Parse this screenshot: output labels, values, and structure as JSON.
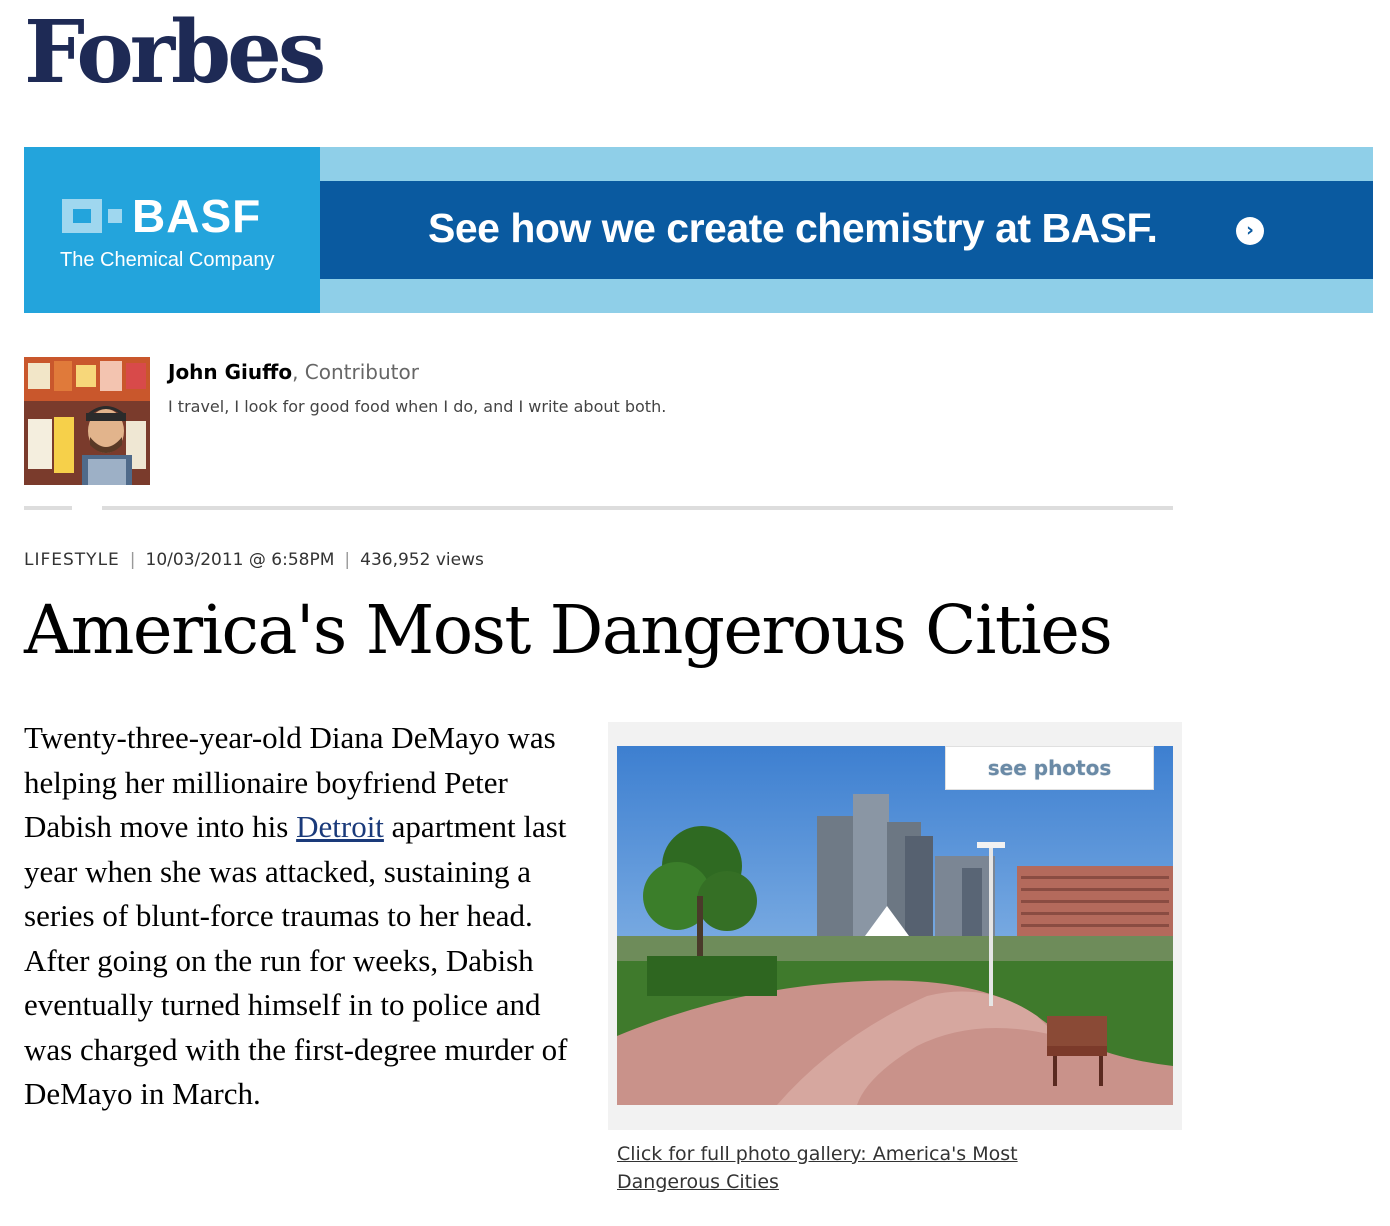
{
  "header": {
    "logo": "Forbes"
  },
  "ad": {
    "brand": "BASF",
    "company": "The Chemical Company",
    "tagline": "See how we create chemistry at BASF.",
    "arrow": "›",
    "colors": {
      "band": "#0a5aa0",
      "brand_bg": "#23a4dc",
      "light": "#8fcfe8"
    }
  },
  "author": {
    "name": "John Giuffo",
    "role": ", Contributor",
    "bio": "I travel, I look for good food when I do, and I write about both."
  },
  "meta": {
    "channel": "LIFESTYLE",
    "separator": "|",
    "date": "10/03/2011 @ 6:58PM",
    "views": "436,952 views"
  },
  "article": {
    "headline": "America's Most Dangerous Cities",
    "body_before": "Twenty-three-year-old Diana DeMayo was helping her millionaire boyfriend Peter Dabish move into his ",
    "body_link": "Detroit",
    "body_after": " apartment last year when she was attacked, sustaining a series of blunt-force traumas to her head. After going on the run for weeks, Dabish eventually turned himself in to police and was charged with the first-degree murder of DeMayo in March."
  },
  "photo": {
    "see_photos": "see photos",
    "caption": "Click for full photo gallery: America's Most Dangerous Cities"
  }
}
